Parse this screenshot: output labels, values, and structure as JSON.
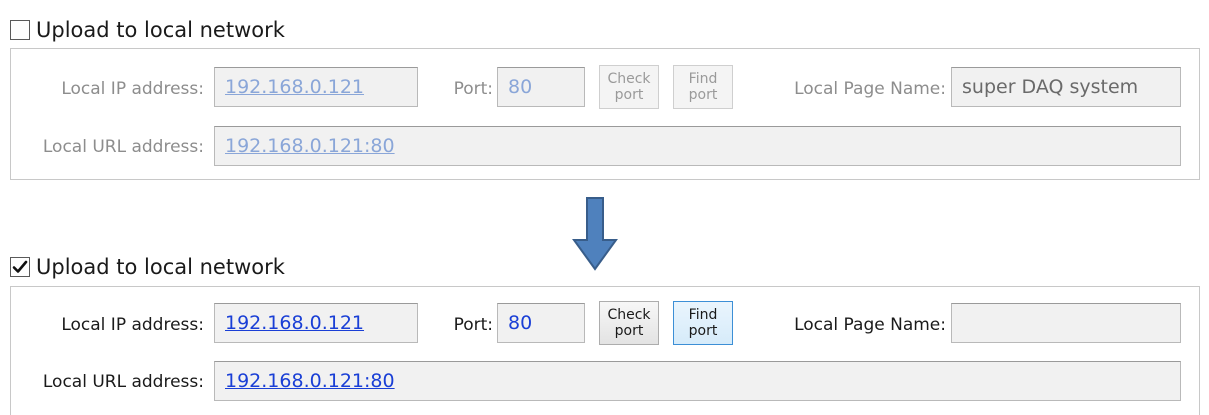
{
  "top": {
    "checkbox_label": "Upload to local network",
    "checked": false,
    "ip_label": "Local IP address:",
    "ip_value": "192.168.0.121",
    "port_label": "Port:",
    "port_value": "80",
    "check_port_line1": "Check",
    "check_port_line2": "port",
    "find_port_line1": "Find",
    "find_port_line2": "port",
    "page_name_label": "Local Page Name:",
    "page_name_value": "super DAQ system",
    "url_label": "Local URL address:",
    "url_value": "192.168.0.121:80"
  },
  "bottom": {
    "checkbox_label": "Upload to local network",
    "checked": true,
    "ip_label": "Local IP address:",
    "ip_value": "192.168.0.121",
    "port_label": "Port:",
    "port_value": "80",
    "check_port_line1": "Check",
    "check_port_line2": "port",
    "find_port_line1": "Find",
    "find_port_line2": "port",
    "page_name_label": "Local Page Name:",
    "page_name_value": "",
    "url_label": "Local URL address:",
    "url_value": "192.168.0.121:80"
  },
  "icons": {
    "arrow": "arrow-down-icon",
    "check": "check-mark-icon"
  },
  "colors": {
    "arrow_fill": "#4f81bd",
    "arrow_stroke": "#385d8a",
    "link_enabled": "#1a3fd6",
    "link_disabled": "#8aa6d8"
  }
}
